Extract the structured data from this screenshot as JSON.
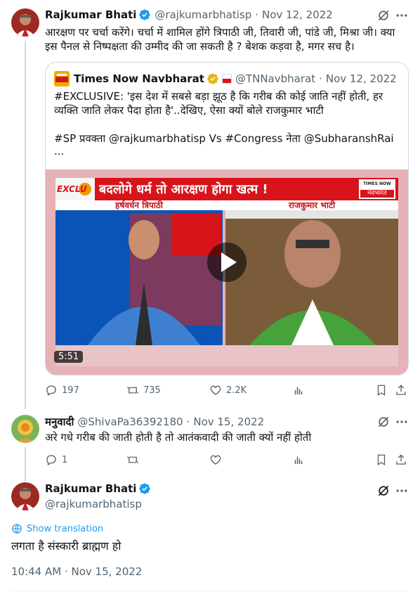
{
  "tweet1": {
    "name": "Rajkumar Bhati",
    "handle": "@rajkumarbhatisp",
    "date": "Nov 12, 2022",
    "text_line1": "आरक्षण पर चर्चा करेंगे। चर्चा में शामिल होंगे त्रिपाठी जी, तिवारी जी, पांडे जी, मिश्रा जी। क्या",
    "text_line2": "इस पैनल से निष्पक्षता की उम्मीद की जा सकती है ? बेशक कड़वा है, मगर सच है।",
    "quote": {
      "name": "Times Now Navbharat",
      "handle": "@TNNavbharat",
      "date": "Nov 12, 2022",
      "line1": "#EXCLUSIVE: 'इस देश में सबसे बड़ा झूठ है कि गरीब की कोई जाति नहीं होती, हर",
      "line2": "व्यक्ति जाति लेकर पैदा होता है'..देखिए, ऐसा क्यों बोले राजकुमार भाटी",
      "line3": "#SP प्रवक्ता @rajkumarbhatisp Vs #Congress नेता @SubharanshRai",
      "line4": "...",
      "video": {
        "banner_tag": "EXCLU",
        "headline": "बदलोगे धर्म तो आरक्षण होगा खत्म !",
        "logo_top": "TIMES NOW",
        "logo_bottom": "नवभारत",
        "left_name": "हर्षवर्धन त्रिपाठी",
        "right_name": "राजकुमार भाटी",
        "duration": "5:51"
      }
    },
    "stats": {
      "replies": "197",
      "retweets": "735",
      "likes": "2.2K"
    }
  },
  "tweet2": {
    "name": "मनुवादी",
    "handle": "@ShivaPa36392180",
    "date": "Nov 15, 2022",
    "text": "अरे गधे गरीब की जाती होती है तो आतंकवादी की जाती क्यों नहीं होती",
    "stats": {
      "replies": "1"
    }
  },
  "tweet3": {
    "name": "Rajkumar Bhati",
    "handle": "@rajkumarbhatisp",
    "translate": "Show translation",
    "text": "लगता है संस्कारी ब्राह्मण हो",
    "timestamp": "10:44 AM · Nov 15, 2022"
  },
  "colors": {
    "accent": "#1d9bf0",
    "muted": "#536471",
    "border": "#cfd9de",
    "banner_red": "#d8131a"
  }
}
